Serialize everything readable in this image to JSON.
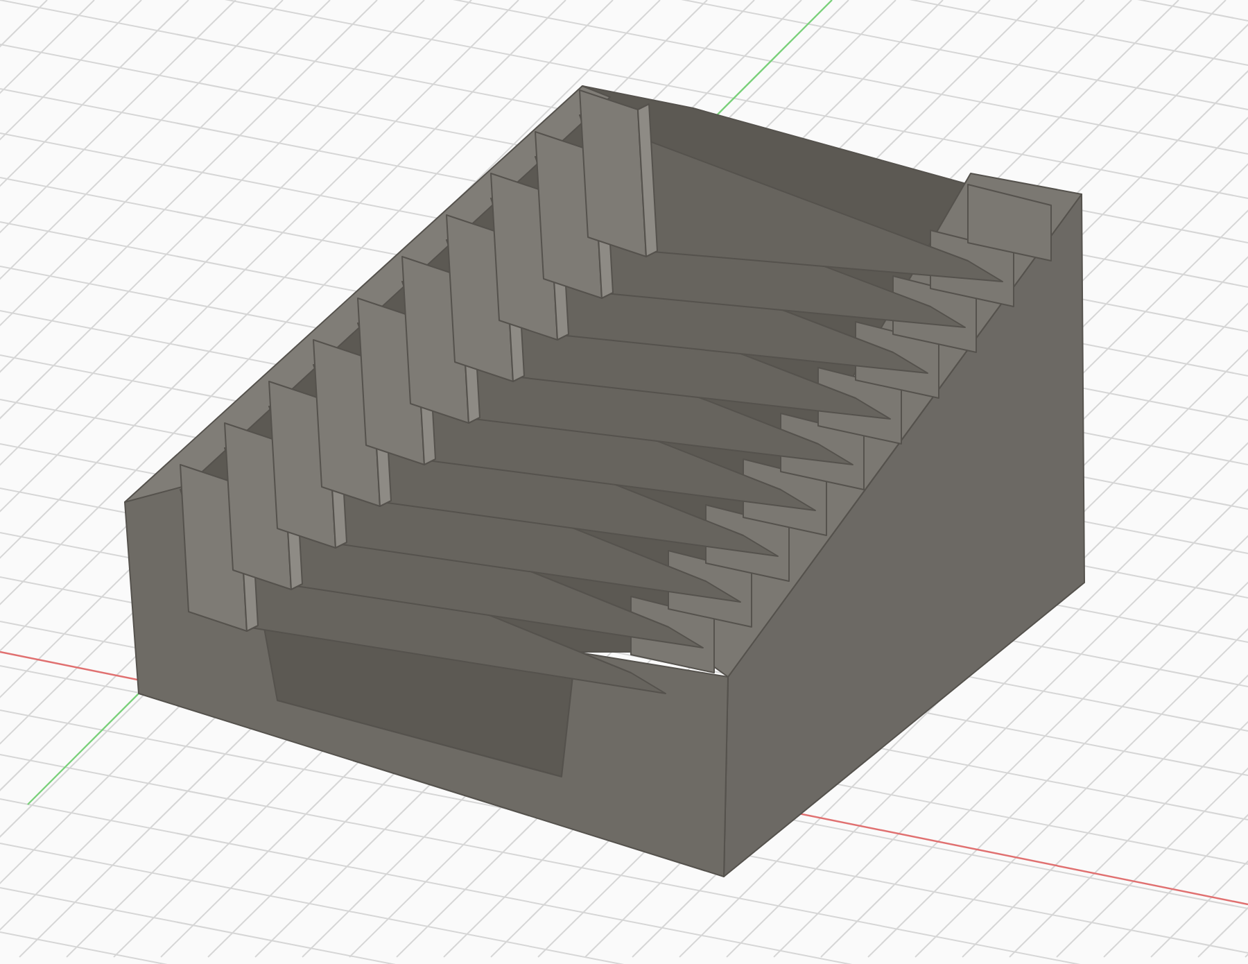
{
  "viewport": {
    "grid": true,
    "axes": [
      {
        "kind": "x",
        "color": "#e07070"
      },
      {
        "kind": "y",
        "color": "#7ad07a"
      }
    ]
  }
}
